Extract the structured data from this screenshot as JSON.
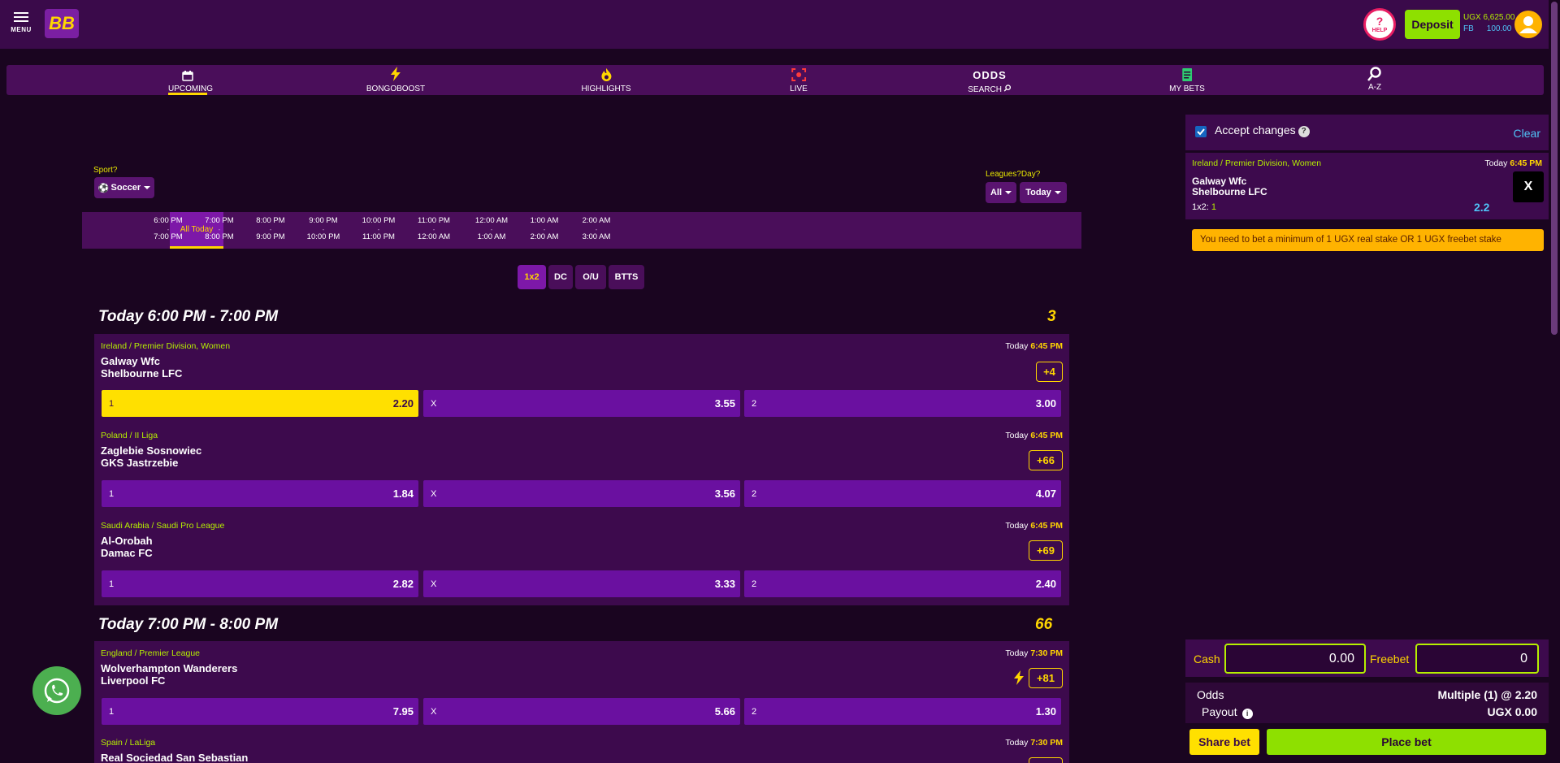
{
  "header": {
    "menu_label": "MENU",
    "logo_text": "BB",
    "help_label": "HELP",
    "help_symbol": "?",
    "deposit_label": "Deposit",
    "cash_balance": "UGX 6,625.00",
    "freebet_label": "FB",
    "freebet_balance": "100.00"
  },
  "nav": [
    {
      "label": "UPCOMING",
      "icon": "calendar-icon"
    },
    {
      "label": "BONGOBOOST",
      "icon": "bolt-icon"
    },
    {
      "label": "HIGHLIGHTS",
      "icon": "flame-icon"
    },
    {
      "label": "LIVE",
      "icon": "live-icon"
    },
    {
      "label": "ODDS",
      "label2": "SEARCH",
      "icon": "search-icon"
    },
    {
      "label": "MY BETS",
      "icon": "receipt-icon"
    },
    {
      "label": "A-Z",
      "icon": "search-icon"
    }
  ],
  "filters": {
    "sport_label": "Sport?",
    "sport_value": "Soccer",
    "leagues_label": "Leagues?Day?",
    "league_value": "All",
    "day_value": "Today"
  },
  "time_slots": {
    "all_today": "All Today",
    "slots": [
      {
        "from": "6:00 PM",
        "to": "7:00 PM"
      },
      {
        "from": "7:00 PM",
        "to": "8:00 PM"
      },
      {
        "from": "8:00 PM",
        "to": "9:00 PM"
      },
      {
        "from": "9:00 PM",
        "to": "10:00 PM"
      },
      {
        "from": "10:00 PM",
        "to": "11:00 PM"
      },
      {
        "from": "11:00 PM",
        "to": "12:00 AM"
      },
      {
        "from": "12:00 AM",
        "to": "1:00 AM"
      },
      {
        "from": "1:00 AM",
        "to": "2:00 AM"
      },
      {
        "from": "2:00 AM",
        "to": "3:00 AM"
      }
    ],
    "separator": "-"
  },
  "markets": [
    "1x2",
    "DC",
    "O/U",
    "BTTS"
  ],
  "sections": [
    {
      "title": "Today 6:00 PM - 7:00 PM",
      "count": "3",
      "matches": [
        {
          "league": "Ireland / Premier Division, Women",
          "day": "Today",
          "time": "6:45 PM",
          "home": "Galway Wfc",
          "away": "Shelbourne LFC",
          "more": "+4",
          "odds": [
            {
              "label": "1",
              "value": "2.20"
            },
            {
              "label": "X",
              "value": "3.55"
            },
            {
              "label": "2",
              "value": "3.00"
            }
          ]
        },
        {
          "league": "Poland / II Liga",
          "day": "Today",
          "time": "6:45 PM",
          "home": "Zaglebie Sosnowiec",
          "away": "GKS Jastrzebie",
          "more": "+66",
          "odds": [
            {
              "label": "1",
              "value": "1.84"
            },
            {
              "label": "X",
              "value": "3.56"
            },
            {
              "label": "2",
              "value": "4.07"
            }
          ]
        },
        {
          "league": "Saudi Arabia / Saudi Pro League",
          "day": "Today",
          "time": "6:45 PM",
          "home": "Al-Orobah",
          "away": "Damac FC",
          "more": "+69",
          "odds": [
            {
              "label": "1",
              "value": "2.82"
            },
            {
              "label": "X",
              "value": "3.33"
            },
            {
              "label": "2",
              "value": "2.40"
            }
          ]
        }
      ]
    },
    {
      "title": "Today 7:00 PM - 8:00 PM",
      "count": "66",
      "matches": [
        {
          "league": "England / Premier League",
          "day": "Today",
          "time": "7:30 PM",
          "home": "Wolverhampton Wanderers",
          "away": "Liverpool FC",
          "more": "+81",
          "odds": [
            {
              "label": "1",
              "value": "7.95"
            },
            {
              "label": "X",
              "value": "5.66"
            },
            {
              "label": "2",
              "value": "1.30"
            }
          ]
        },
        {
          "league": "Spain / LaLiga",
          "day": "Today",
          "time": "7:30 PM",
          "home": "Real Sociedad San Sebastian",
          "away": "",
          "more": "",
          "odds": []
        }
      ]
    }
  ],
  "betslip": {
    "accept_changes": "Accept changes",
    "help_symbol": "?",
    "clear": "Clear",
    "selection": {
      "league": "Ireland / Premier Division, Women",
      "day": "Today",
      "time": "6:45 PM",
      "home": "Galway Wfc",
      "away": "Shelbourne LFC",
      "market": "1x2:",
      "pick": "1",
      "odds": "2.2",
      "remove": "X"
    },
    "warning": "You need to bet a minimum of 1 UGX real stake OR 1 UGX freebet stake",
    "cash_label": "Cash",
    "cash_value": "0.00",
    "freebet_label": "Freebet",
    "freebet_value": "0",
    "odds_label": "Odds",
    "odds_value": "Multiple (1) @ 2.20",
    "payout_label": "Payout",
    "info_symbol": "i",
    "payout_value": "UGX 0.00",
    "share_label": "Share bet",
    "place_label": "Place bet"
  },
  "colors": {
    "background": "#1a0520",
    "panel": "#3d0a4d",
    "accent_yellow": "#ffd600",
    "accent_green": "#8ee000",
    "odds_button": "#6a10a0"
  }
}
